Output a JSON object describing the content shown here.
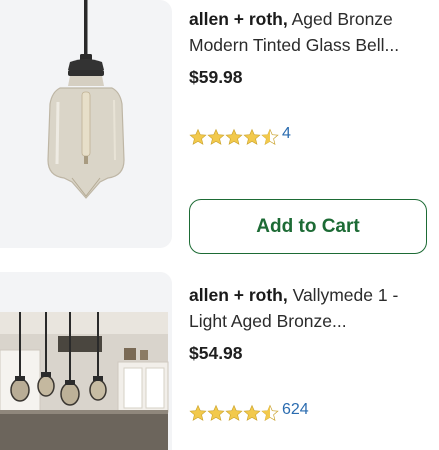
{
  "products": [
    {
      "brand": "allen + roth,",
      "name": "Aged Bronze Modern Tinted Glass Bell...",
      "price": "$59.98",
      "rating": 4.5,
      "review_count": "4",
      "add_to_cart": "Add to Cart",
      "image": "pendant-light-tinted-glass"
    },
    {
      "brand": "allen + roth,",
      "name": "Vallymede 1 - Light Aged Bronze...",
      "price": "$54.98",
      "rating": 4.5,
      "review_count": "624",
      "image": "kitchen-pendant-lights-photo"
    }
  ],
  "colors": {
    "star": "#f2c94c",
    "star_stroke": "#c9a12a",
    "link": "#2b6cb0",
    "button": "#1d6b35",
    "thumb_bg": "#f3f4f6"
  }
}
